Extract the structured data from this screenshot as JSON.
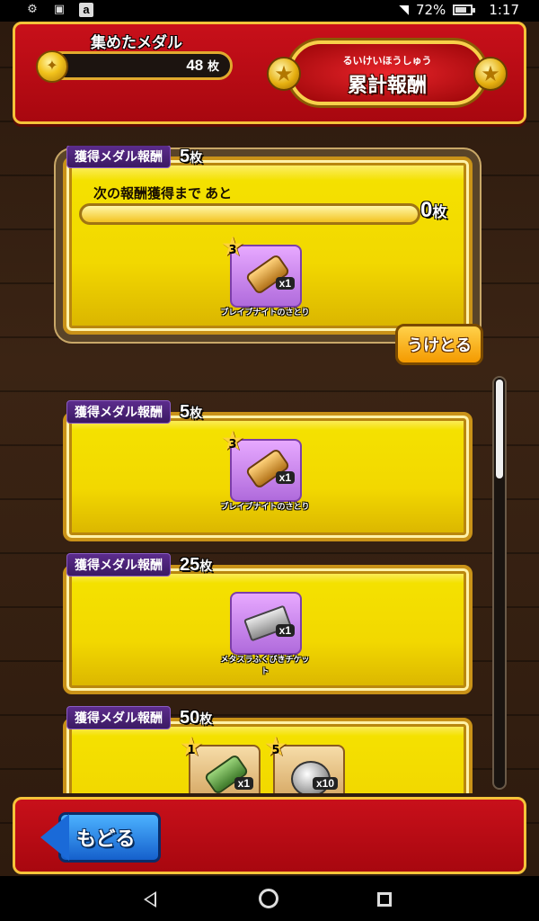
{
  "status_bar": {
    "icons": [
      "settings-icon",
      "image-icon",
      "amazon-icon"
    ],
    "amazon_glyph": "a",
    "wifi": "wifi-icon",
    "battery_percent": "72%",
    "battery_level": 0.72,
    "time": "1:17"
  },
  "header": {
    "title": "集めたメダル",
    "medal_count": "48",
    "medal_unit": "枚",
    "badge_ruby": "るいけいほうしゅう",
    "badge_title": "累計報酬"
  },
  "reward_cards": [
    {
      "label": "獲得メダル報酬",
      "amount": "5",
      "unit": "枚",
      "active": true,
      "progress_text": "次の報酬獲得まで あと",
      "progress_remaining": "0",
      "progress_unit": "枚",
      "progress_fraction": 1.0,
      "items": [
        {
          "name": "ブレイブナイトのさとり",
          "qty": "x1",
          "stars": "3",
          "kind": "scroll-gold"
        }
      ],
      "claim_label": "うけとる"
    },
    {
      "label": "獲得メダル報酬",
      "amount": "5",
      "unit": "枚",
      "items": [
        {
          "name": "ブレイブナイトのさとり",
          "qty": "x1",
          "stars": "3",
          "kind": "scroll-gold"
        }
      ]
    },
    {
      "label": "獲得メダル報酬",
      "amount": "25",
      "unit": "枚",
      "items": [
        {
          "name": "メタスラふくびきチケット",
          "qty": "x1",
          "kind": "ticket"
        }
      ]
    },
    {
      "label": "獲得メダル報酬",
      "amount": "50",
      "unit": "枚",
      "items": [
        {
          "name": "",
          "qty": "x1",
          "stars": "1",
          "kind": "scroll-green"
        },
        {
          "name": "",
          "qty": "x10",
          "stars": "5",
          "kind": "silver"
        }
      ]
    }
  ],
  "footer": {
    "back_label": "もどる"
  },
  "nav_bar": {
    "buttons": [
      "back-nav-icon",
      "home-nav-icon",
      "recent-apps-icon"
    ]
  },
  "colors": {
    "header_red": "#b80b14",
    "gold_border": "#f5c33a",
    "card_yellow": "#f2d800",
    "label_purple": "#4a2378",
    "button_orange": "#f49a00",
    "back_blue": "#1a6ad8"
  }
}
